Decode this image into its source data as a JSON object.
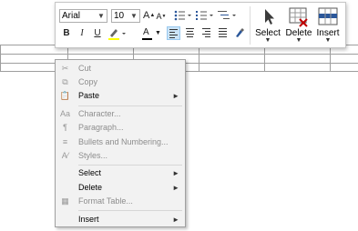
{
  "toolbar": {
    "font_name": "Arial",
    "font_size": "10",
    "grow_font": "A",
    "shrink_font": "A",
    "bold": "B",
    "italic": "I",
    "underline": "U",
    "font_color": "A",
    "select_label": "Select",
    "delete_label": "Delete",
    "insert_label": "Insert",
    "accent": "#2b579a",
    "delete_color": "#c00000"
  },
  "menu": {
    "cut": "Cut",
    "copy": "Copy",
    "paste": "Paste",
    "character": "Character...",
    "paragraph": "Paragraph...",
    "bullets": "Bullets and Numbering...",
    "styles": "Styles...",
    "select": "Select",
    "delete": "Delete",
    "format_table": "Format Table...",
    "insert": "Insert",
    "submenu_arrow": "►"
  }
}
